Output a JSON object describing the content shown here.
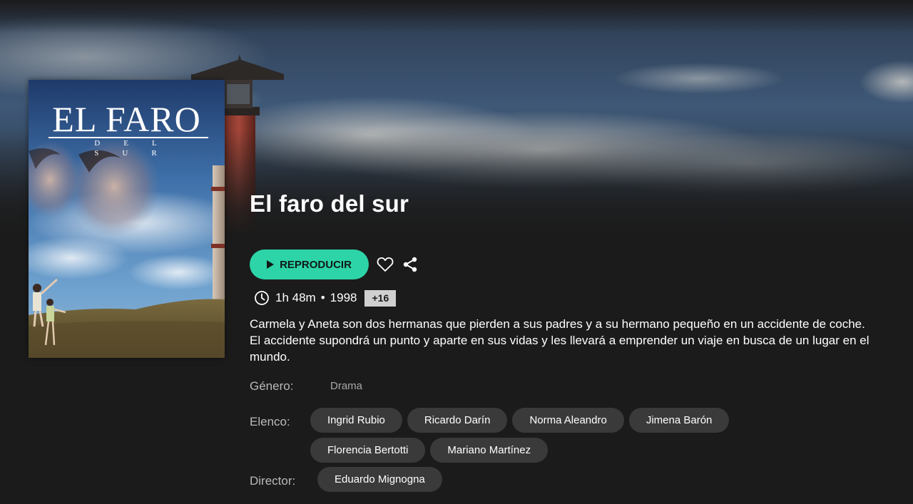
{
  "movie": {
    "title": "El faro del sur",
    "duration": "1h 48m",
    "separator": "•",
    "year": "1998",
    "age_rating": "+16",
    "synopsis": "Carmela y Aneta son dos hermanas que pierden a sus padres y a su hermano pequeño en un accidente de coche. El accidente supondrá un punto y aparte en sus vidas y les llevará a emprender un viaje en busca de un lugar en el mundo."
  },
  "poster": {
    "title": "EL FARO",
    "subtitle": "DEL SUR"
  },
  "actions": {
    "play_label": "REPRODUCIR",
    "favorite_icon": "heart-outline-icon",
    "share_icon": "share-icon"
  },
  "details": {
    "genre_label": "Género:",
    "genre_value": "Drama",
    "cast_label": "Elenco:",
    "cast": [
      "Ingrid Rubio",
      "Ricardo Darín",
      "Norma Aleandro",
      "Jimena Barón",
      "Florencia Bertotti",
      "Mariano Martínez"
    ],
    "director_label": "Director:",
    "directors": [
      "Eduardo Mignogna"
    ]
  },
  "colors": {
    "accent": "#2dd4a7",
    "background": "#1b1b1b",
    "chip": "#3a3a3a",
    "rating_badge": "#d0d0d0"
  }
}
